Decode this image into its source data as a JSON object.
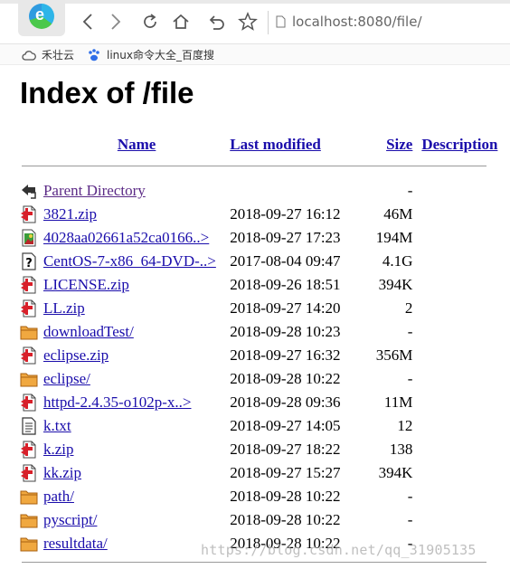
{
  "browser": {
    "logo_letter": "e",
    "url": "localhost:8080/file/",
    "bookmarks": [
      {
        "label": "禾壮云",
        "icon": "cloud-icon"
      },
      {
        "label": "linux命令大全_百度搜",
        "icon": "baidu-paw-icon"
      }
    ]
  },
  "page": {
    "title": "Index of /file",
    "columns": {
      "name": "Name",
      "last_modified": "Last modified",
      "size": "Size",
      "description": "Description"
    },
    "parent": {
      "label": "Parent Directory",
      "size": "-",
      "icon": "back-arrow-icon"
    },
    "rows": [
      {
        "name": "3821.zip",
        "modified": "2018-09-27 16:12",
        "size": "46M",
        "icon": "compressed-file-icon"
      },
      {
        "name": "4028aa02661a52ca0166..>",
        "modified": "2018-09-27 17:23",
        "size": "194M",
        "icon": "image-file-icon"
      },
      {
        "name": "CentOS-7-x86_64-DVD-..>",
        "modified": "2017-08-04 09:47",
        "size": "4.1G",
        "icon": "unknown-file-icon"
      },
      {
        "name": "LICENSE.zip",
        "modified": "2018-09-26 18:51",
        "size": "394K",
        "icon": "compressed-file-icon"
      },
      {
        "name": "LL.zip",
        "modified": "2018-09-27 14:20",
        "size": "2",
        "icon": "compressed-file-icon"
      },
      {
        "name": "downloadTest/",
        "modified": "2018-09-28 10:23",
        "size": "-",
        "icon": "folder-icon"
      },
      {
        "name": "eclipse.zip",
        "modified": "2018-09-27 16:32",
        "size": "356M",
        "icon": "compressed-file-icon"
      },
      {
        "name": "eclipse/",
        "modified": "2018-09-28 10:22",
        "size": "-",
        "icon": "folder-icon"
      },
      {
        "name": "httpd-2.4.35-o102p-x..>",
        "modified": "2018-09-28 09:36",
        "size": "11M",
        "icon": "compressed-file-icon"
      },
      {
        "name": "k.txt",
        "modified": "2018-09-27 14:05",
        "size": "12",
        "icon": "text-file-icon"
      },
      {
        "name": "k.zip",
        "modified": "2018-09-27 18:22",
        "size": "138",
        "icon": "compressed-file-icon"
      },
      {
        "name": "kk.zip",
        "modified": "2018-09-27 15:27",
        "size": "394K",
        "icon": "compressed-file-icon"
      },
      {
        "name": "path/",
        "modified": "2018-09-28 10:22",
        "size": "-",
        "icon": "folder-icon"
      },
      {
        "name": "pyscript/",
        "modified": "2018-09-28 10:22",
        "size": "-",
        "icon": "folder-icon"
      },
      {
        "name": "resultdata/",
        "modified": "2018-09-28 10:22",
        "size": "-",
        "icon": "folder-icon"
      }
    ]
  },
  "watermark": "https://blog.csdn.net/qq_31905135",
  "colors": {
    "link": "#1a0dab",
    "visited_link": "#5b2a86",
    "folder": "#f0a840",
    "zip_red": "#d8202a"
  }
}
